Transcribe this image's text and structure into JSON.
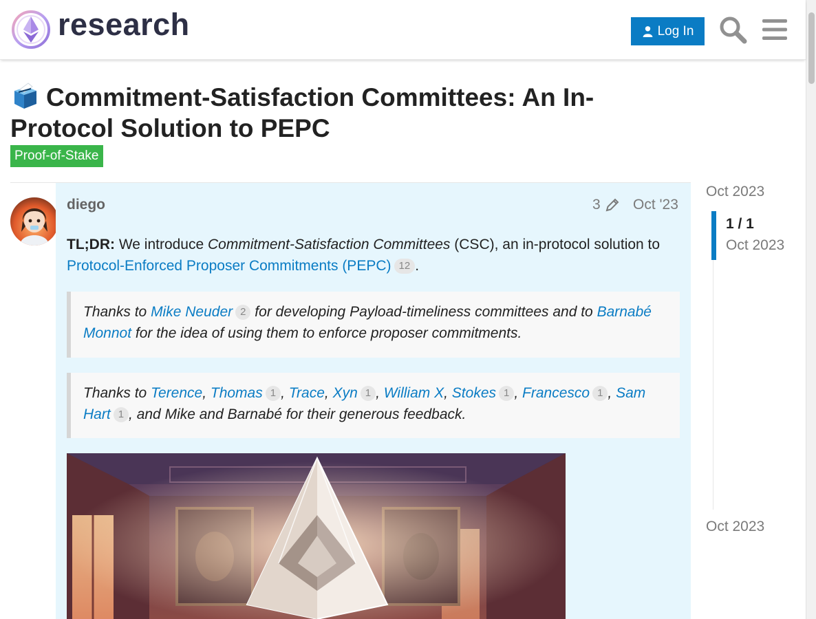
{
  "header": {
    "site_name": "research",
    "login_label": "Log In"
  },
  "topic": {
    "title": "Commitment-Satisfaction Committees: An In-Protocol Solution to PEPC",
    "category": "Proof-of-Stake",
    "category_color": "#3ab54a"
  },
  "post": {
    "username": "diego",
    "edit_count": "3",
    "date": "Oct '23",
    "tldr_label": "TL;DR:",
    "intro_1": " We introduce ",
    "intro_em": "Commitment-Satisfaction Committees",
    "intro_2": " (CSC), an in-protocol solution to ",
    "pepc_link": "Protocol-Enforced Proposer Commitments (PEPC)",
    "pepc_count": "12",
    "intro_end": ".",
    "quote1": {
      "t1": "Thanks to ",
      "link1": "Mike Neuder",
      "count1": "2",
      "t2": " for developing Payload-timeliness committees and to ",
      "link2": "Barnabé Monnot",
      "t3": " for the idea of using them to enforce proposer commitments."
    },
    "quote2": {
      "t1": "Thanks to ",
      "terence": "Terence",
      "thomas": "Thomas",
      "thomas_count": "1",
      "trace": "Trace",
      "xyn": "Xyn",
      "xyn_count": "1",
      "williamx": "William X",
      "stokes": "Stokes",
      "stokes_count": "1",
      "francesco": "Francesco",
      "francesco_count": "1",
      "samhart": "Sam Hart",
      "samhart_count": "1",
      "comma": ",",
      "t_end": ", and Mike and Barnabé for their generous feedback."
    }
  },
  "timeline": {
    "start": "Oct 2023",
    "position": "1 / 1",
    "current_date": "Oct 2023",
    "end": "Oct 2023"
  },
  "colors": {
    "accent": "#0a7cc4",
    "post_highlight": "#e6f6fd"
  }
}
